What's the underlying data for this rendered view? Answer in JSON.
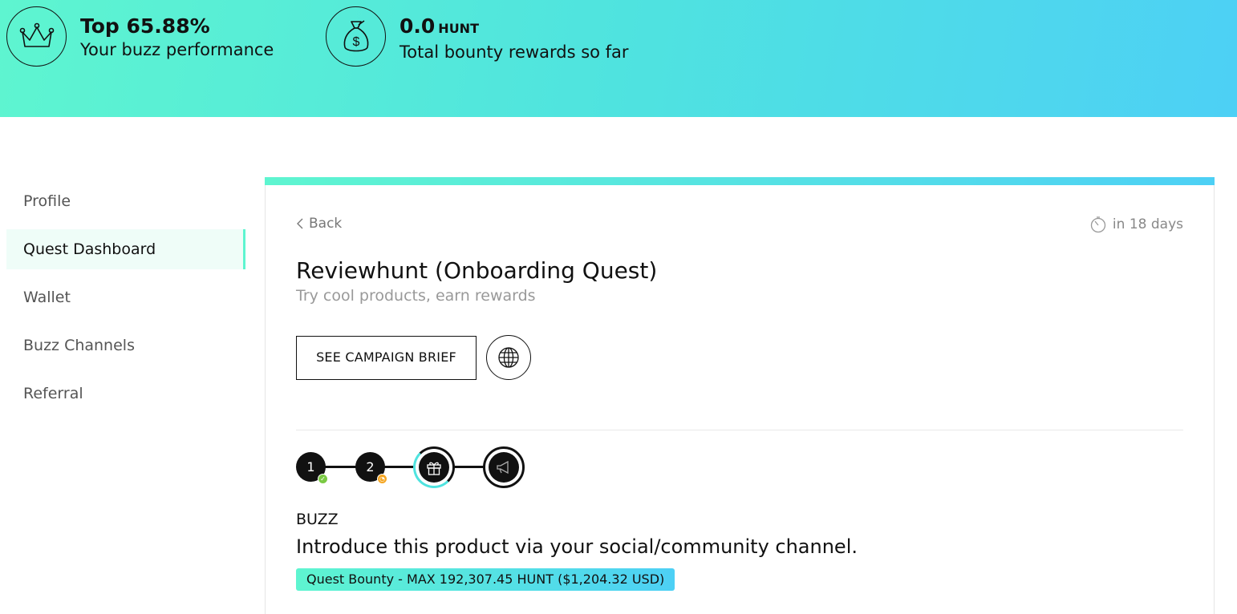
{
  "header": {
    "performance": {
      "value": "Top 65.88%",
      "label": "Your buzz performance",
      "icon": "crown-icon"
    },
    "rewards": {
      "value": "0.0",
      "unit": "HUNT",
      "label": "Total bounty rewards so far",
      "icon": "money-bag-icon"
    }
  },
  "sidebar": {
    "items": [
      {
        "label": "Profile"
      },
      {
        "label": "Quest Dashboard",
        "active": true
      },
      {
        "label": "Wallet"
      },
      {
        "label": "Buzz Channels"
      },
      {
        "label": "Referral"
      }
    ]
  },
  "quest": {
    "back_label": "Back",
    "time_left": "in 18 days",
    "title": "Reviewhunt (Onboarding Quest)",
    "subtitle": "Try cool products, earn rewards",
    "brief_button": "SEE CAMPAIGN BRIEF",
    "steps": [
      {
        "label": "1",
        "status": "done"
      },
      {
        "label": "2",
        "status": "pending"
      },
      {
        "icon": "gift-icon",
        "status": "in-progress"
      },
      {
        "icon": "megaphone-icon",
        "status": "locked"
      }
    ],
    "step_label": "BUZZ",
    "description": "Introduce this product via your social/community channel.",
    "bounty": "Quest Bounty - MAX 192,307.45 HUNT ($1,204.32 USD)"
  },
  "colors": {
    "accent_start": "#5ef5d0",
    "accent_end": "#4dd0f5",
    "done": "#7ac943",
    "pending": "#f5a623"
  }
}
